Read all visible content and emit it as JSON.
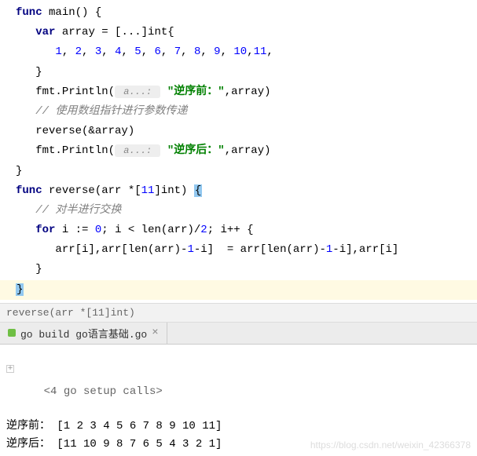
{
  "code": {
    "l1_func": "func",
    "l1_main": " main() {",
    "l2_var": "var",
    "l2_rest": " array = [...]int{",
    "l3_nums": [
      "1",
      "2",
      "3",
      "4",
      "5",
      "6",
      "7",
      "8",
      "9",
      "10",
      "11"
    ],
    "l4": "}",
    "l5_a": "fmt.Println(",
    "l5_hint": " a...: ",
    "l5_str": "\"逆序前：\"",
    "l5_b": ",array)",
    "l6_comment": "// 使用数组指针进行参数传递",
    "l7": "reverse(&array)",
    "l8_a": "fmt.Println(",
    "l8_hint": " a...: ",
    "l8_str": "\"逆序后：\"",
    "l8_b": ",array)",
    "l9": "}",
    "l10_func": "func",
    "l10_rest": " reverse(arr *[",
    "l10_n": "11",
    "l10_rest2": "]int) ",
    "l10_brace": "{",
    "l11_comment": "// 对半进行交换",
    "l12_for": "for",
    "l12_a": " i := ",
    "l12_zero": "0",
    "l12_b": "; i < len(arr)/",
    "l12_two": "2",
    "l12_c": "; i++ {",
    "l13_a": "arr[i],arr[len(arr)-",
    "l13_one1": "1",
    "l13_b": "-i]  = arr[len(arr)-",
    "l13_one2": "1",
    "l13_c": "-i],arr[i]",
    "l14": "}",
    "l15": "}"
  },
  "breadcrumb": "reverse(arr *[11]int)",
  "tab": {
    "label": "go build go语言基础.go",
    "close": "×"
  },
  "console": {
    "folded": "<4 go setup calls>",
    "line1": "逆序前： [1 2 3 4 5 6 7 8 9 10 11]",
    "line2": "逆序后： [11 10 9 8 7 6 5 4 3 2 1]"
  },
  "watermark": "https://blog.csdn.net/weixin_42366378"
}
